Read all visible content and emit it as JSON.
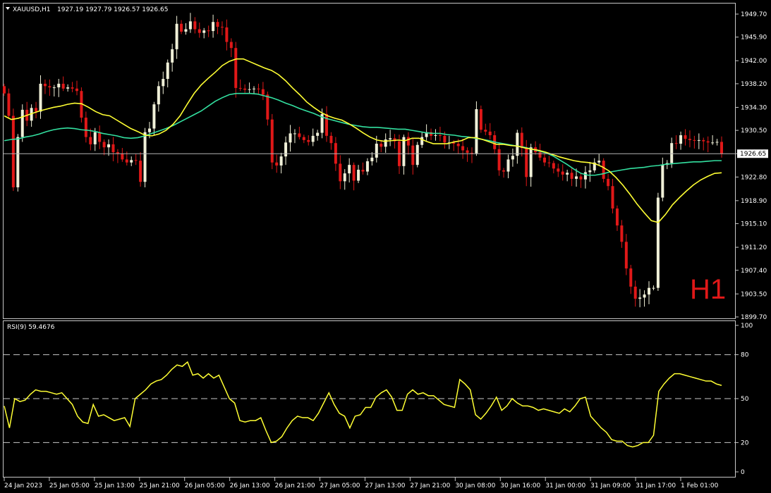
{
  "header": {
    "symbol": "XAUUSD,H1",
    "ohlc": "1927.19 1927.79 1926.57 1926.65"
  },
  "timeframe_watermark": "H1",
  "current_price_label": "1926.65",
  "colors": {
    "bull": "#f0f0d8",
    "bear": "#e01818",
    "fast_ma": "#ffff33",
    "slow_ma": "#33e0a0",
    "rsi": "#ffff33",
    "grid_frame": "#c8c8c8",
    "price_line": "#b4b4b4"
  },
  "chart_data": [
    {
      "type": "candlestick",
      "ylim": [
        1899.7,
        1949.7
      ],
      "yticks": [
        "1949.70",
        "1945.90",
        "1942.00",
        "1938.20",
        "1934.30",
        "1930.50",
        "1926.65",
        "1922.80",
        "1918.90",
        "1915.10",
        "1911.20",
        "1907.40",
        "1903.50",
        "1899.70"
      ],
      "xticks": [
        "24 Jan 2023",
        "25 Jan 05:00",
        "25 Jan 13:00",
        "25 Jan 21:00",
        "26 Jan 05:00",
        "26 Jan 13:00",
        "26 Jan 21:00",
        "27 Jan 05:00",
        "27 Jan 13:00",
        "27 Jan 21:00",
        "30 Jan 08:00",
        "30 Jan 16:00",
        "31 Jan 00:00",
        "31 Jan 09:00",
        "31 Jan 17:00",
        "1 Feb 01:00"
      ],
      "close": [
        1936.6,
        1932.9,
        1921.1,
        1929.4,
        1933.9,
        1932.1,
        1934.2,
        1933.6,
        1938.2,
        1937.8,
        1937.6,
        1937.6,
        1938.2,
        1937.4,
        1937.6,
        1937.4,
        1937.0,
        1932.6,
        1929.4,
        1928.2,
        1930.2,
        1928.6,
        1927.7,
        1928.2,
        1926.9,
        1926.7,
        1925.7,
        1925.2,
        1925.6,
        1925.5,
        1922.0,
        1930.2,
        1930.8,
        1934.8,
        1937.8,
        1939.0,
        1941.7,
        1943.9,
        1948.1,
        1946.8,
        1947.2,
        1948.5,
        1947.2,
        1946.6,
        1947.0,
        1946.9,
        1948.4,
        1947.6,
        1947.5,
        1945.1,
        1944.1,
        1937.5,
        1937.4,
        1937.2,
        1937.3,
        1937.4,
        1937.3,
        1936.4,
        1932.3,
        1925.2,
        1924.7,
        1926.2,
        1928.5,
        1930.0,
        1930.0,
        1929.4,
        1928.9,
        1928.6,
        1929.6,
        1930.1,
        1933.2,
        1929.6,
        1928.4,
        1925.0,
        1922.1,
        1923.4,
        1924.8,
        1922.2,
        1924.0,
        1923.7,
        1925.4,
        1926.0,
        1928.3,
        1927.8,
        1929.0,
        1929.2,
        1928.7,
        1924.6,
        1929.4,
        1928.0,
        1924.8,
        1928.1,
        1929.4,
        1930.2,
        1929.6,
        1929.7,
        1929.6,
        1928.5,
        1928.5,
        1928.3,
        1927.9,
        1927.2,
        1926.8,
        1926.7,
        1934.0,
        1930.6,
        1930.3,
        1929.7,
        1927.4,
        1923.9,
        1923.7,
        1925.7,
        1926.3,
        1930.1,
        1927.6,
        1922.8,
        1927.7,
        1926.9,
        1926.0,
        1925.2,
        1925.1,
        1924.2,
        1923.7,
        1923.2,
        1923.5,
        1922.5,
        1922.9,
        1922.4,
        1923.6,
        1923.9,
        1925.2,
        1925.5,
        1922.5,
        1921.3,
        1917.6,
        1914.8,
        1912.1,
        1907.7,
        1904.7,
        1902.7,
        1902.9,
        1903.4,
        1904.5,
        1904.5,
        1919.4,
        1924.8,
        1925.1,
        1928.4,
        1928.3,
        1929.7,
        1929.1,
        1928.9,
        1928.8,
        1928.9,
        1928.7,
        1928.5,
        1928.5,
        1928.6,
        1926.6
      ],
      "fast_ma": [
        1932.9,
        1932.3,
        1932.5,
        1932.9,
        1933.3,
        1933.7,
        1934.0,
        1934.3,
        1934.5,
        1934.8,
        1935.0,
        1934.9,
        1934.3,
        1933.6,
        1933.1,
        1932.9,
        1932.2,
        1931.5,
        1930.8,
        1930.3,
        1929.7,
        1929.6,
        1929.9,
        1930.5,
        1931.5,
        1932.9,
        1934.8,
        1936.6,
        1938.0,
        1939.1,
        1940.1,
        1941.2,
        1941.9,
        1942.3,
        1942.3,
        1941.8,
        1941.3,
        1940.8,
        1940.4,
        1939.7,
        1938.7,
        1937.5,
        1936.4,
        1935.2,
        1934.3,
        1933.5,
        1932.9,
        1932.5,
        1932.2,
        1931.6,
        1930.9,
        1930.1,
        1929.4,
        1928.9,
        1928.7,
        1928.8,
        1928.9,
        1928.8,
        1929.2,
        1929.2,
        1928.7,
        1928.3,
        1928.3,
        1928.3,
        1928.6,
        1928.8,
        1929.3,
        1929.3,
        1929.0,
        1928.6,
        1928.2,
        1928.2,
        1928.0,
        1927.9,
        1927.6,
        1927.4,
        1927.2,
        1926.9,
        1926.5,
        1926.1,
        1925.8,
        1925.5,
        1925.3,
        1925.2,
        1925.0,
        1924.5,
        1923.8,
        1922.7,
        1921.4,
        1919.9,
        1918.3,
        1916.9,
        1915.6,
        1915.3,
        1916.6,
        1918.2,
        1919.4,
        1920.5,
        1921.5,
        1922.3,
        1922.9,
        1923.4,
        1923.5
      ],
      "slow_ma": [
        1928.8,
        1929.0,
        1929.1,
        1929.4,
        1929.6,
        1929.9,
        1930.3,
        1930.6,
        1930.8,
        1930.9,
        1930.8,
        1930.6,
        1930.5,
        1930.3,
        1930.0,
        1929.8,
        1929.6,
        1929.3,
        1929.2,
        1929.3,
        1929.6,
        1930.0,
        1930.4,
        1930.8,
        1931.3,
        1931.9,
        1932.5,
        1933.1,
        1933.7,
        1934.5,
        1935.3,
        1935.9,
        1936.4,
        1936.6,
        1936.6,
        1936.6,
        1936.5,
        1936.2,
        1935.9,
        1935.5,
        1935.0,
        1934.6,
        1934.1,
        1933.7,
        1933.3,
        1932.8,
        1932.4,
        1932.1,
        1931.8,
        1931.5,
        1931.3,
        1931.1,
        1931.0,
        1931.0,
        1930.9,
        1930.8,
        1930.7,
        1930.7,
        1930.5,
        1930.3,
        1930.1,
        1930.0,
        1930.0,
        1929.8,
        1929.7,
        1929.5,
        1929.4,
        1929.2,
        1929.0,
        1928.8,
        1928.5,
        1928.3,
        1928.1,
        1927.9,
        1927.7,
        1927.4,
        1927.1,
        1926.8,
        1926.3,
        1925.6,
        1924.9,
        1924.1,
        1923.4,
        1923.1,
        1923.1,
        1923.3,
        1923.6,
        1923.8,
        1924.0,
        1924.2,
        1924.3,
        1924.4,
        1924.6,
        1924.7,
        1924.9,
        1925.0,
        1925.1,
        1925.2,
        1925.3,
        1925.3,
        1925.4,
        1925.5,
        1925.5
      ]
    },
    {
      "type": "line",
      "title": "RSI(9) 59.4676",
      "ylim": [
        0,
        100
      ],
      "yticks": [
        100,
        80,
        50,
        20,
        0
      ],
      "levels": [
        80,
        50,
        20
      ],
      "values": [
        45,
        30,
        50,
        48,
        49,
        53,
        56,
        55,
        55,
        54,
        53,
        54,
        50,
        46,
        38,
        34,
        33,
        46,
        38,
        39,
        37,
        35,
        36,
        37,
        31,
        50,
        53,
        56,
        60,
        62,
        63,
        66,
        70,
        73,
        72,
        75,
        66,
        67,
        64,
        67,
        64,
        66,
        58,
        50,
        47,
        35,
        34,
        35,
        35,
        37,
        28,
        20,
        21,
        24,
        30,
        35,
        38,
        37,
        37,
        35,
        40,
        47,
        54,
        46,
        40,
        38,
        30,
        38,
        39,
        44,
        44,
        51,
        54,
        56,
        51,
        42,
        42,
        53,
        56,
        53,
        54,
        52,
        52,
        49,
        46,
        45,
        44,
        63,
        60,
        56,
        39,
        36,
        40,
        45,
        51,
        42,
        45,
        50,
        47,
        45,
        45,
        44,
        42,
        43,
        42,
        41,
        40,
        43,
        41,
        45,
        50,
        51,
        38,
        34,
        30,
        27,
        22,
        21,
        21,
        18,
        17,
        18,
        20,
        20,
        25,
        55,
        60,
        64,
        67,
        67,
        66,
        65,
        64,
        63,
        62,
        62,
        60,
        59
      ]
    }
  ]
}
